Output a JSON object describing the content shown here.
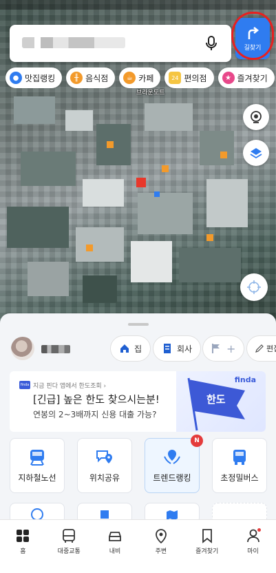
{
  "map": {
    "place_label": "브라운도트",
    "colors": {
      "marker": "#e8372a",
      "accent_orange": "#f39a2b"
    }
  },
  "search": {
    "mic_icon": "mic-icon"
  },
  "route_button": {
    "label": "길찾기",
    "icon": "turn-right-arrow-icon",
    "color": "#2f7cf0"
  },
  "chips": [
    {
      "label": "맛집랭킹",
      "icon": "pin-ranking-icon",
      "color": "#2f7cf0"
    },
    {
      "label": "음식점",
      "icon": "utensils-icon",
      "color": "#f39a2b"
    },
    {
      "label": "카페",
      "icon": "coffee-icon",
      "color": "#f39a2b"
    },
    {
      "label": "편의점",
      "icon": "store-24-icon",
      "color": "#f5c542"
    },
    {
      "label": "즐겨찾기",
      "icon": "star-icon",
      "color": "#e8488a"
    }
  ],
  "sheet": {
    "quick_buttons": [
      {
        "label": "집",
        "icon": "home-icon"
      },
      {
        "label": "회사",
        "icon": "building-icon"
      },
      {
        "label": "+",
        "icon": "flag-icon"
      },
      {
        "label": "편집",
        "icon": "pencil-icon"
      }
    ],
    "ad": {
      "source": "지금 핀다 앱에서 한도조회 ›",
      "title": "[긴급] 높은 한도 찾으시는분!",
      "subtitle": "연봉의 2~3배까지 신용 대출 가능?",
      "brand": "finda",
      "logo_text": "finda",
      "flag_text": "한도"
    },
    "tiles": [
      {
        "label": "지하철노선",
        "icon": "subway-icon"
      },
      {
        "label": "위치공유",
        "icon": "location-share-icon"
      },
      {
        "label": "트렌드랭킹",
        "icon": "trend-ranking-icon",
        "badge": "N"
      },
      {
        "label": "초정밀버스",
        "icon": "bus-icon"
      }
    ]
  },
  "nav": [
    {
      "label": "홈",
      "icon": "home-grid-icon"
    },
    {
      "label": "대중교통",
      "icon": "bus-front-icon"
    },
    {
      "label": "내비",
      "icon": "car-icon"
    },
    {
      "label": "주변",
      "icon": "map-pin-icon"
    },
    {
      "label": "즐겨찾기",
      "icon": "bookmark-icon"
    },
    {
      "label": "마이",
      "icon": "person-icon"
    }
  ]
}
